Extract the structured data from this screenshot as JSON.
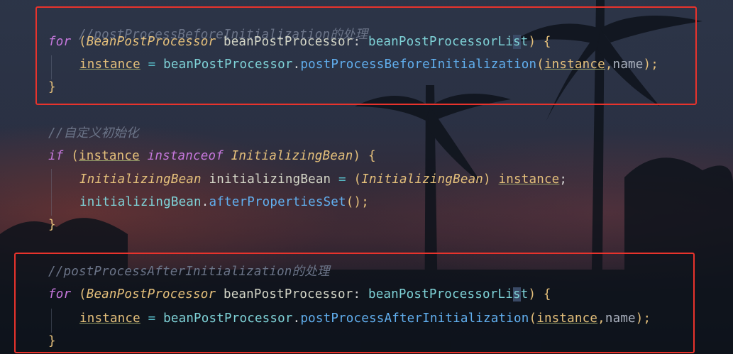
{
  "colors": {
    "keyword": "#c678dd",
    "class": "#e5c07b",
    "method": "#61afef",
    "comment": "#6b7488",
    "highlight_box": "#e8332c"
  },
  "code": {
    "c1": "//postProcessBeforeInitialization的处理",
    "for1": {
      "kw": "for",
      "open": " (",
      "type": "BeanPostProcessor",
      "var": " beanPostProcessor",
      "colon": ": ",
      "list_a": "beanPostProcessorLi",
      "list_b": "s",
      "list_c": "t",
      "close": ") {"
    },
    "l2": {
      "field": "instance",
      "eq": " = ",
      "recv": "beanPostProcessor",
      "dot": ".",
      "method": "postProcessBeforeInitialization",
      "open": "(",
      "arg": "instance",
      "comma": ",",
      "name": "name",
      "end": ");"
    },
    "brace1": "}",
    "c2": "//自定义初始化",
    "if": {
      "kw": "if",
      "open": " (",
      "field": "instance",
      "sp": " ",
      "kw2": "instanceof",
      "type": " InitializingBean",
      "close": ") {"
    },
    "l5": {
      "type": "InitializingBean",
      "var": " initializingBean",
      "eq": " = ",
      "open": "(",
      "cast": "InitializingBean",
      "close": ") ",
      "field": "instance",
      "end": ";"
    },
    "l6": {
      "recv": "initializingBean",
      "dot": ".",
      "method": "afterPropertiesSet",
      "end": "();"
    },
    "brace2": "}",
    "c3": "//postProcessAfterInitialization的处理",
    "for2": {
      "kw": "for",
      "open": " (",
      "type": "BeanPostProcessor",
      "var": " beanPostProcessor",
      "colon": ": ",
      "list_a": "beanPostProcessorLi",
      "list_b": "s",
      "list_c": "t",
      "close": ") {"
    },
    "l9": {
      "field": "instance",
      "eq": " = ",
      "recv": "beanPostProcessor",
      "dot": ".",
      "method": "postProcessAfterInitialization",
      "open": "(",
      "arg": "instance",
      "comma": ",",
      "name": "name",
      "end": ");"
    },
    "brace3": "}"
  }
}
